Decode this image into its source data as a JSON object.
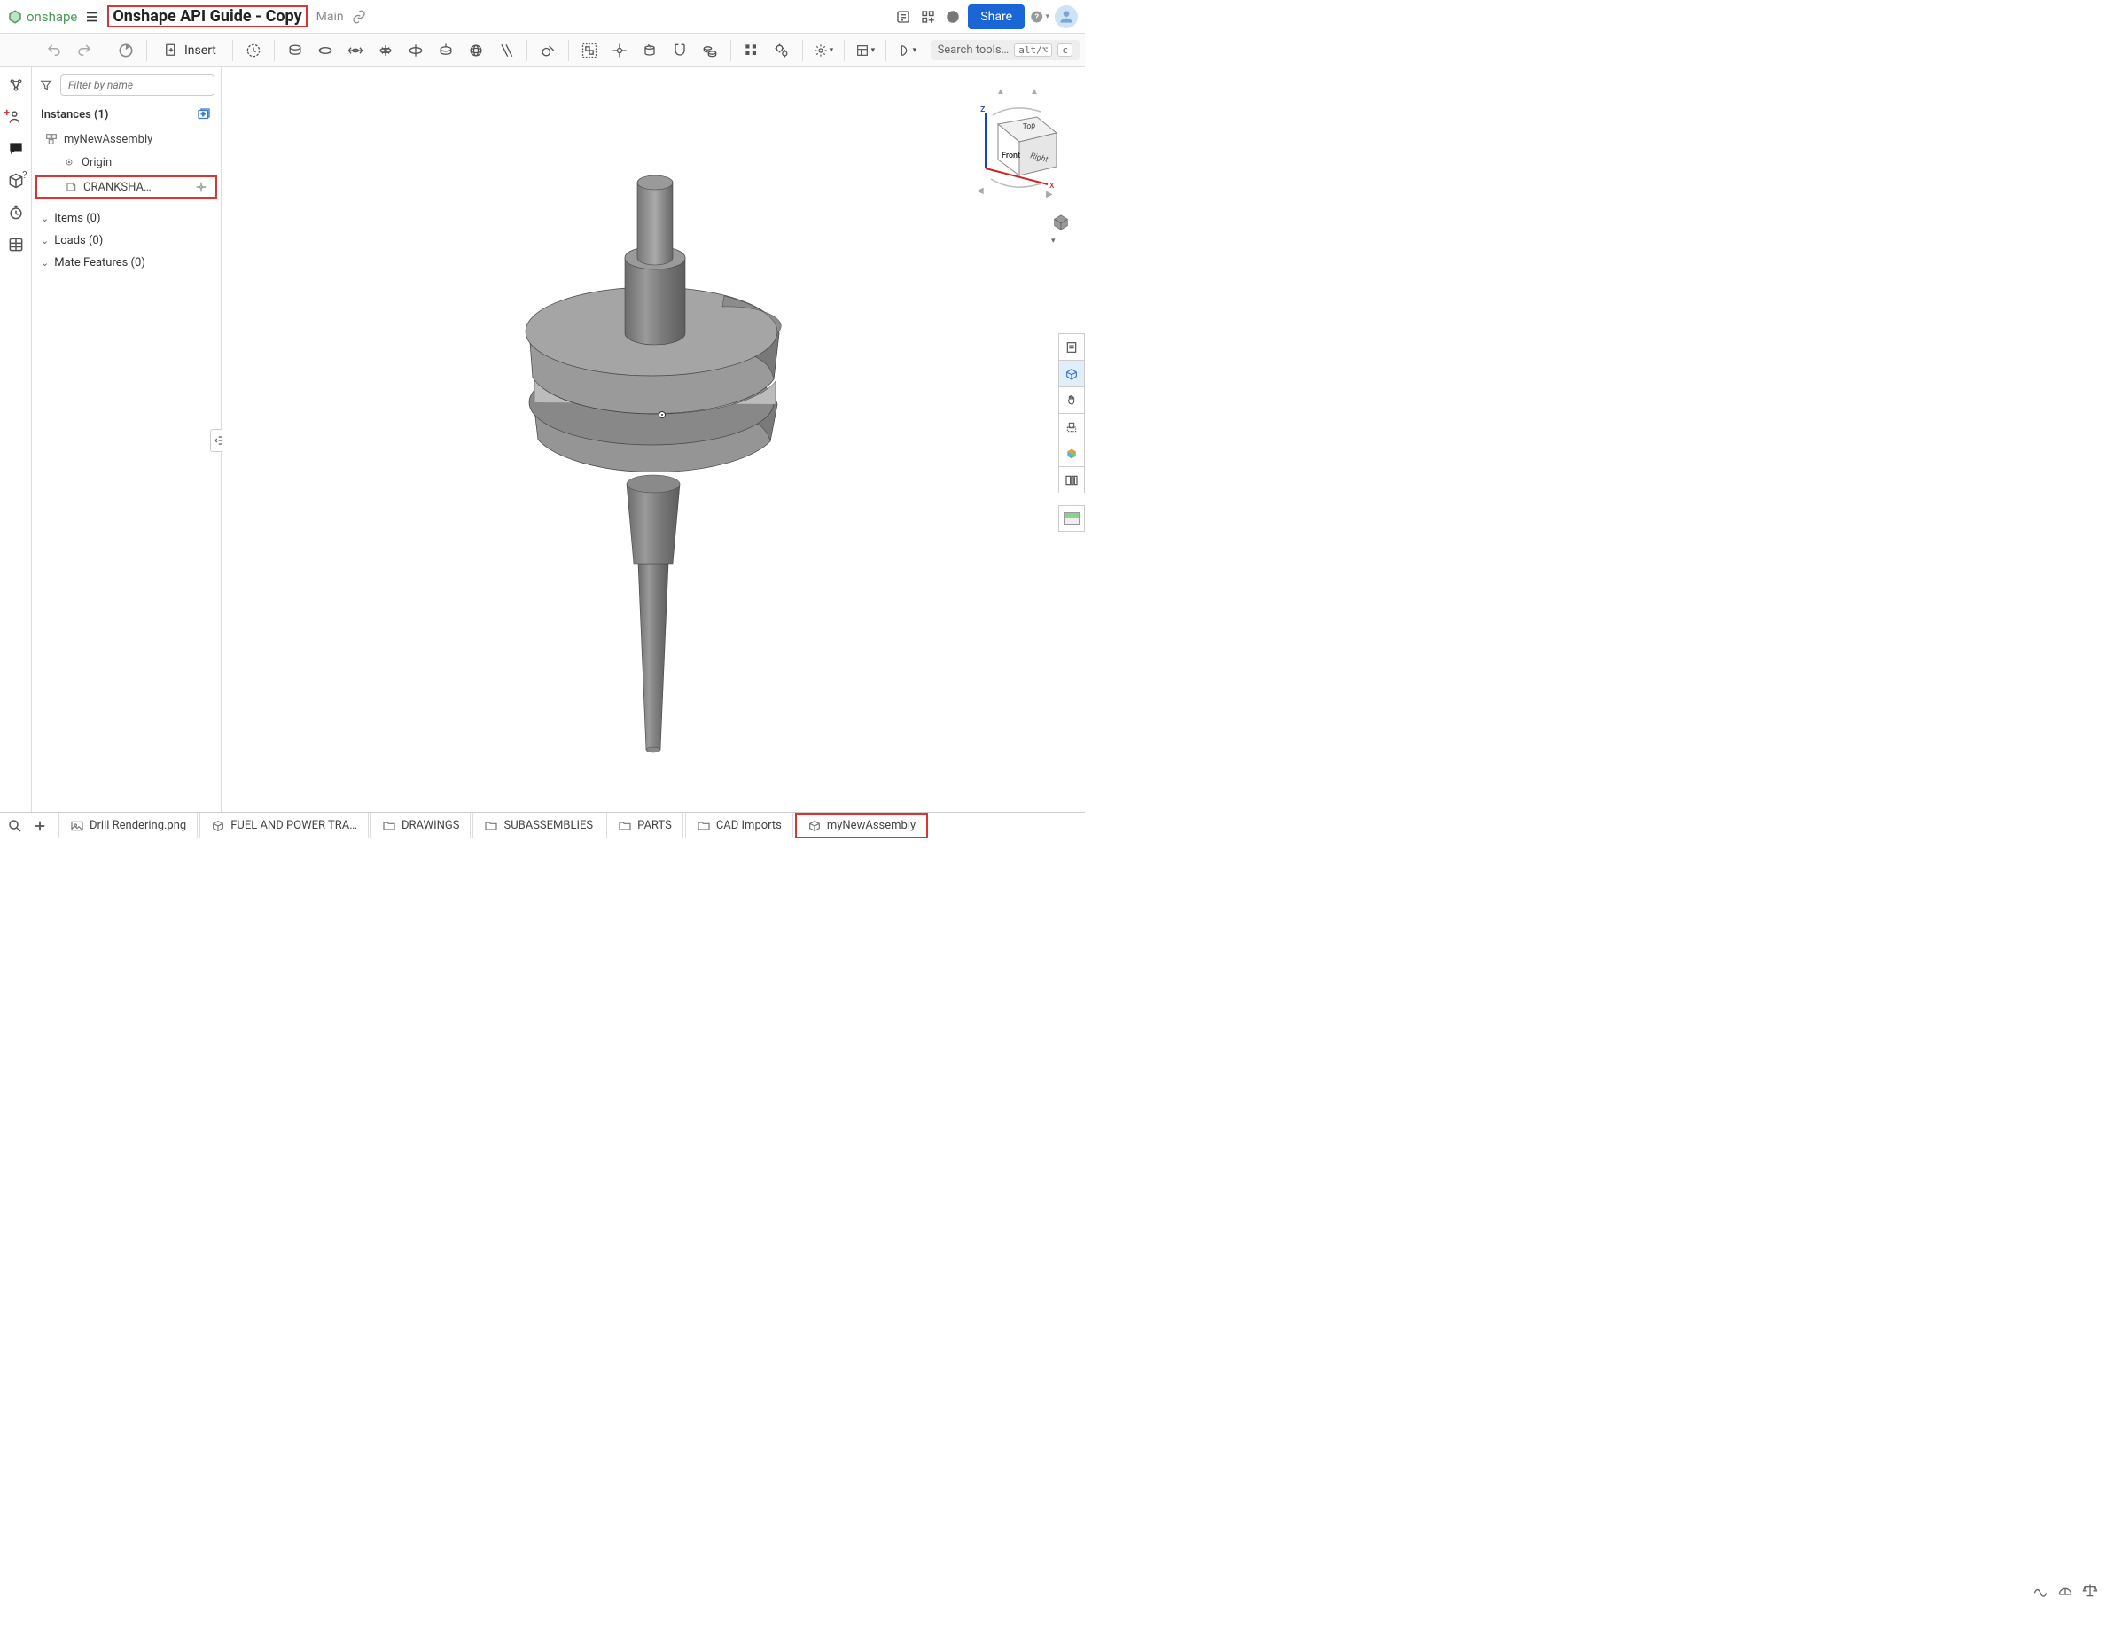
{
  "topbar": {
    "brand": "onshape",
    "doc_title": "Onshape API Guide - Copy",
    "branch": "Main",
    "share": "Share"
  },
  "toolbar": {
    "insert": "Insert",
    "search_placeholder": "Search tools…",
    "kbd1": "alt/⌥",
    "kbd2": "c"
  },
  "panel": {
    "filter_placeholder": "Filter by name",
    "instances_header": "Instances (1)",
    "tree": {
      "assembly": "myNewAssembly",
      "origin": "Origin",
      "crankshaft": "CRANKSHA…"
    },
    "sections": {
      "items": "Items (0)",
      "loads": "Loads (0)",
      "mates": "Mate Features (0)"
    }
  },
  "viewcube": {
    "top": "Top",
    "front": "Front",
    "right": "Right",
    "z": "z",
    "x": "x"
  },
  "tabs": [
    {
      "icon": "image",
      "label": "Drill Rendering.png"
    },
    {
      "icon": "cube",
      "label": "FUEL AND POWER TRA…"
    },
    {
      "icon": "folder",
      "label": "DRAWINGS"
    },
    {
      "icon": "folder",
      "label": "SUBASSEMBLIES"
    },
    {
      "icon": "folder",
      "label": "PARTS"
    },
    {
      "icon": "folder",
      "label": "CAD Imports"
    },
    {
      "icon": "cube",
      "label": "myNewAssembly",
      "active": true
    }
  ]
}
